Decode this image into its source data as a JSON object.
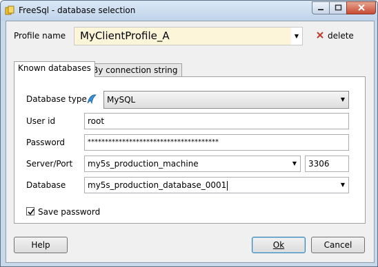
{
  "window": {
    "title": "FreeSql - database selection"
  },
  "profile": {
    "label": "Profile name",
    "value": "MyClientProfile_A",
    "delete_label": "delete"
  },
  "tabs": [
    {
      "label": "Known databases",
      "selected": true
    },
    {
      "label": "By connection string",
      "selected": false
    }
  ],
  "form": {
    "db_type_label": "Database type",
    "db_type_value": "MySQL",
    "user_id_label": "User id",
    "user_id_value": "root",
    "password_label": "Password",
    "password_value": "**************************************",
    "server_label": "Server/Port",
    "server_value": "my5s_production_machine",
    "port_value": "3306",
    "database_label": "Database",
    "database_value": "my5s_production_database_0001",
    "save_password_label": "Save password",
    "save_password_checked": true
  },
  "buttons": {
    "help": "Help",
    "ok": "Ok",
    "cancel": "Cancel"
  },
  "colors": {
    "title_bar": "#c8d9ec",
    "profile_field_bg": "#fcf5d9",
    "close_button": "#c74a34",
    "delete_icon": "#c0392b",
    "db_type_icon": "#3a8fd6"
  }
}
